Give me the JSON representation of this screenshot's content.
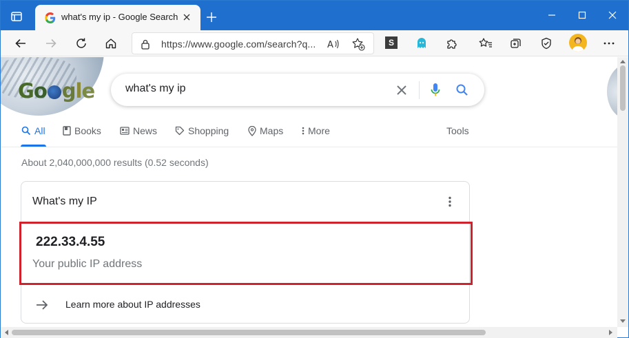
{
  "browser": {
    "tab_title": "what's my ip - Google Search",
    "url": "https://www.google.com/search?q...",
    "extension_s_label": "S"
  },
  "search": {
    "query": "what's my ip",
    "logo_text": "Google"
  },
  "nav_tabs": [
    {
      "label": "All",
      "icon": "search-icon",
      "active": true
    },
    {
      "label": "Books",
      "icon": "book-icon"
    },
    {
      "label": "News",
      "icon": "news-icon"
    },
    {
      "label": "Shopping",
      "icon": "tag-icon"
    },
    {
      "label": "Maps",
      "icon": "map-pin-icon"
    },
    {
      "label": "More",
      "icon": "more-vertical-icon"
    }
  ],
  "tools_label": "Tools",
  "result_stats": "About 2,040,000,000 results (0.52 seconds)",
  "ip_card": {
    "title": "What's my IP",
    "ip_address": "222.33.4.55",
    "ip_caption": "Your public IP address",
    "learn_more": "Learn more about IP addresses"
  },
  "colors": {
    "titlebar": "#1f6fcf",
    "accent": "#1a73e8",
    "highlight_border": "#d0222c"
  }
}
